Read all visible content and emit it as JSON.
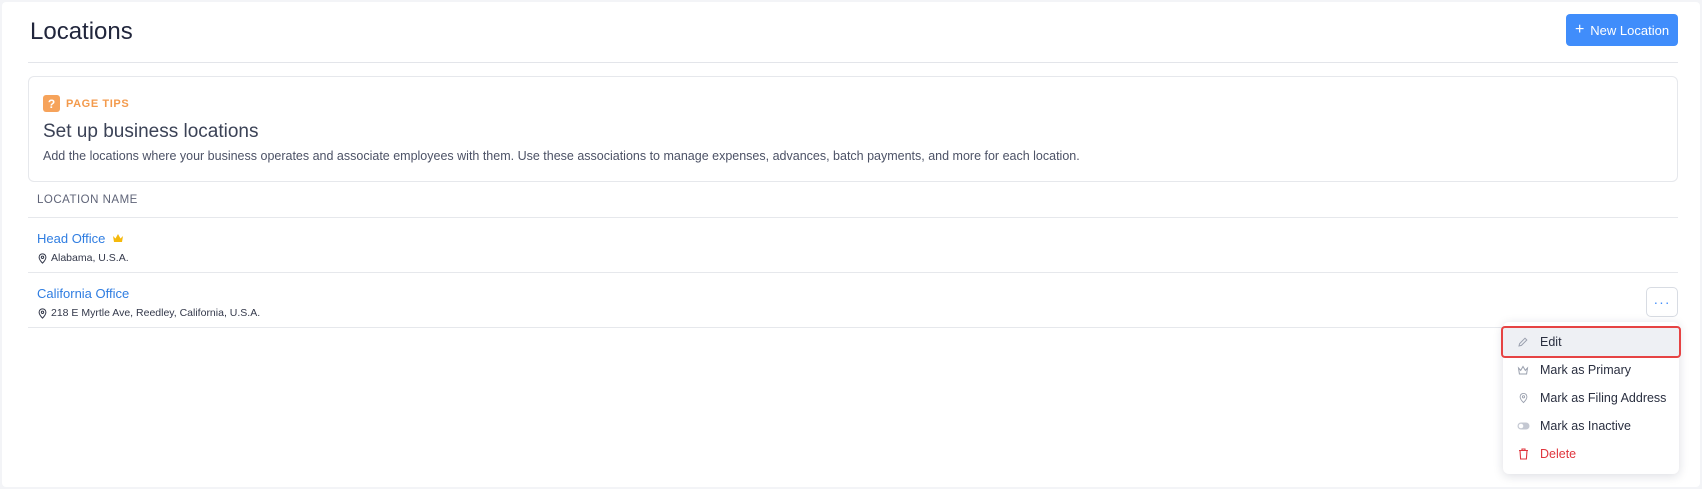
{
  "header": {
    "title": "Locations",
    "new_button_label": "New Location"
  },
  "tips": {
    "tag": "PAGE TIPS",
    "title": "Set up business locations",
    "description": "Add the locations where your business operates and associate employees with them. Use these associations to manage expenses, advances, batch payments, and more for each location."
  },
  "table": {
    "column_header": "LOCATION NAME",
    "rows": [
      {
        "name": "Head Office",
        "address": "Alabama, U.S.A.",
        "primary": true
      },
      {
        "name": "California Office",
        "address": "218 E Myrtle Ave, Reedley, California, U.S.A.",
        "primary": false
      }
    ]
  },
  "menu": {
    "items": [
      {
        "label": "Edit",
        "icon": "pencil-icon"
      },
      {
        "label": "Mark as Primary",
        "icon": "crown-icon"
      },
      {
        "label": "Mark as Filing Address",
        "icon": "location-pin-icon"
      },
      {
        "label": "Mark as Inactive",
        "icon": "toggle-icon"
      },
      {
        "label": "Delete",
        "icon": "trash-icon"
      }
    ]
  },
  "colors": {
    "accent": "#408dfb",
    "link": "#2f7de1",
    "tips_orange": "#f39a4c",
    "crown": "#f5b90c",
    "danger": "#e0353d",
    "highlight_outline": "#e64343"
  }
}
